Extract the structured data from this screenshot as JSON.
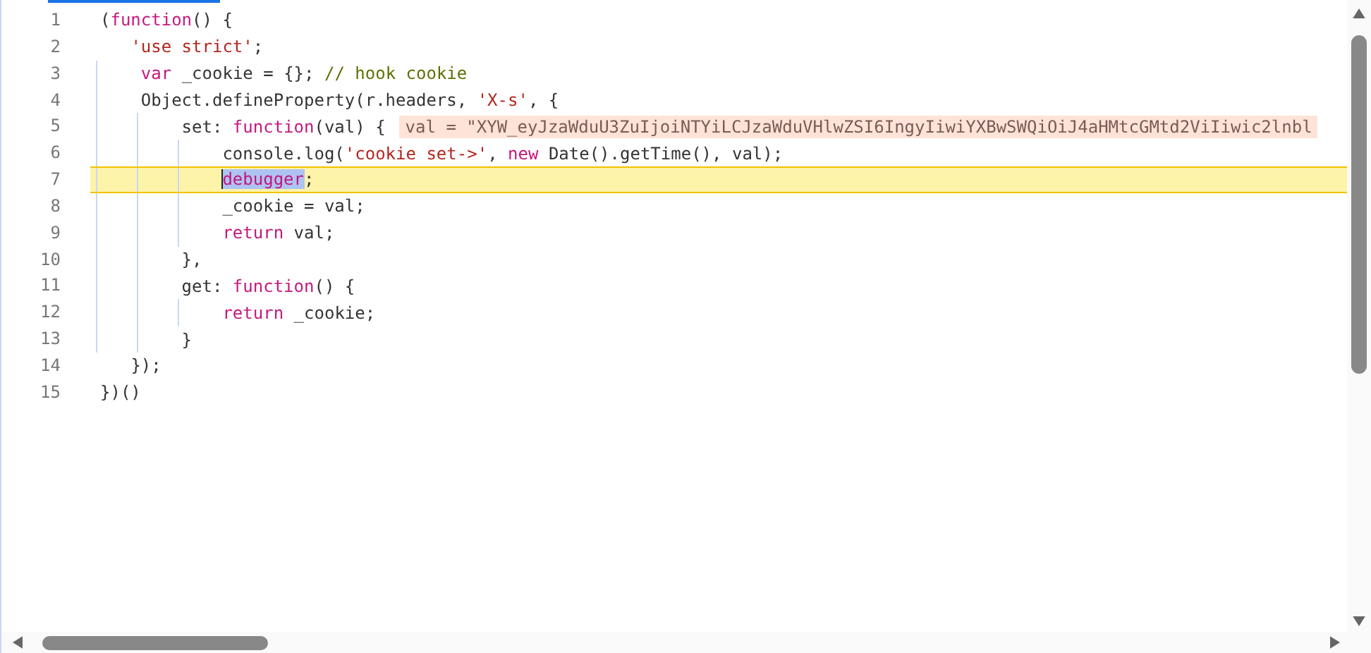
{
  "editor": {
    "lines": [
      {
        "number": "1",
        "highlighted": false,
        "tokens": [
          {
            "text": "(",
            "kind": "plain",
            "selected": false
          },
          {
            "text": "function",
            "kind": "keyword",
            "selected": false
          },
          {
            "text": "() {",
            "kind": "plain",
            "selected": false
          }
        ]
      },
      {
        "number": "2",
        "highlighted": false,
        "tokens": [
          {
            "text": "   'use strict'",
            "kind": "string",
            "selected": false
          },
          {
            "text": ";",
            "kind": "plain",
            "selected": false
          }
        ]
      },
      {
        "number": "3",
        "highlighted": false,
        "tokens": [
          {
            "text": "    var",
            "kind": "keyword",
            "selected": false
          },
          {
            "text": " _cookie = {}; ",
            "kind": "plain",
            "selected": false
          },
          {
            "text": "// hook cookie",
            "kind": "comment",
            "selected": false
          }
        ]
      },
      {
        "number": "4",
        "highlighted": false,
        "tokens": [
          {
            "text": "    Object.defineProperty(r.headers, ",
            "kind": "plain",
            "selected": false
          },
          {
            "text": "'X-s'",
            "kind": "string",
            "selected": false
          },
          {
            "text": ", {",
            "kind": "plain",
            "selected": false
          }
        ]
      },
      {
        "number": "5",
        "highlighted": false,
        "inline_value": "val = \"XYW_eyJzaWduU3ZuIjoiNTYiLCJzaWduVHlwZSI6IngyIiwiYXBwSWQiOiJ4aHMtcGMtd2ViIiwic2lnbl",
        "tokens": [
          {
            "text": "        set: ",
            "kind": "plain",
            "selected": false
          },
          {
            "text": "function",
            "kind": "keyword",
            "selected": false
          },
          {
            "text": "(val) {",
            "kind": "plain",
            "selected": false
          }
        ]
      },
      {
        "number": "6",
        "highlighted": false,
        "tokens": [
          {
            "text": "            console.log(",
            "kind": "plain",
            "selected": false
          },
          {
            "text": "'cookie set->'",
            "kind": "string",
            "selected": false
          },
          {
            "text": ", ",
            "kind": "plain",
            "selected": false
          },
          {
            "text": "new",
            "kind": "keyword",
            "selected": false
          },
          {
            "text": " Date().getTime(), val);",
            "kind": "plain",
            "selected": false
          }
        ]
      },
      {
        "number": "7",
        "highlighted": true,
        "tokens": [
          {
            "text": "            debugger",
            "kind": "keyword",
            "selected": true
          },
          {
            "text": ";",
            "kind": "plain",
            "selected": false
          }
        ]
      },
      {
        "number": "8",
        "highlighted": false,
        "tokens": [
          {
            "text": "            _cookie = val;",
            "kind": "plain",
            "selected": false
          }
        ]
      },
      {
        "number": "9",
        "highlighted": false,
        "tokens": [
          {
            "text": "            return",
            "kind": "keyword",
            "selected": false
          },
          {
            "text": " val;",
            "kind": "plain",
            "selected": false
          }
        ]
      },
      {
        "number": "10",
        "highlighted": false,
        "tokens": [
          {
            "text": "        },",
            "kind": "plain",
            "selected": false
          }
        ]
      },
      {
        "number": "11",
        "highlighted": false,
        "tokens": [
          {
            "text": "        get: ",
            "kind": "plain",
            "selected": false
          },
          {
            "text": "function",
            "kind": "keyword",
            "selected": false
          },
          {
            "text": "() {",
            "kind": "plain",
            "selected": false
          }
        ]
      },
      {
        "number": "12",
        "highlighted": false,
        "tokens": [
          {
            "text": "            return",
            "kind": "keyword",
            "selected": false
          },
          {
            "text": " _cookie;",
            "kind": "plain",
            "selected": false
          }
        ]
      },
      {
        "number": "13",
        "highlighted": false,
        "tokens": [
          {
            "text": "        }",
            "kind": "plain",
            "selected": false
          }
        ]
      },
      {
        "number": "14",
        "highlighted": false,
        "tokens": [
          {
            "text": "   });",
            "kind": "plain",
            "selected": false
          }
        ]
      },
      {
        "number": "15",
        "highlighted": false,
        "tokens": [
          {
            "text": "})()",
            "kind": "plain",
            "selected": false
          }
        ]
      }
    ]
  }
}
